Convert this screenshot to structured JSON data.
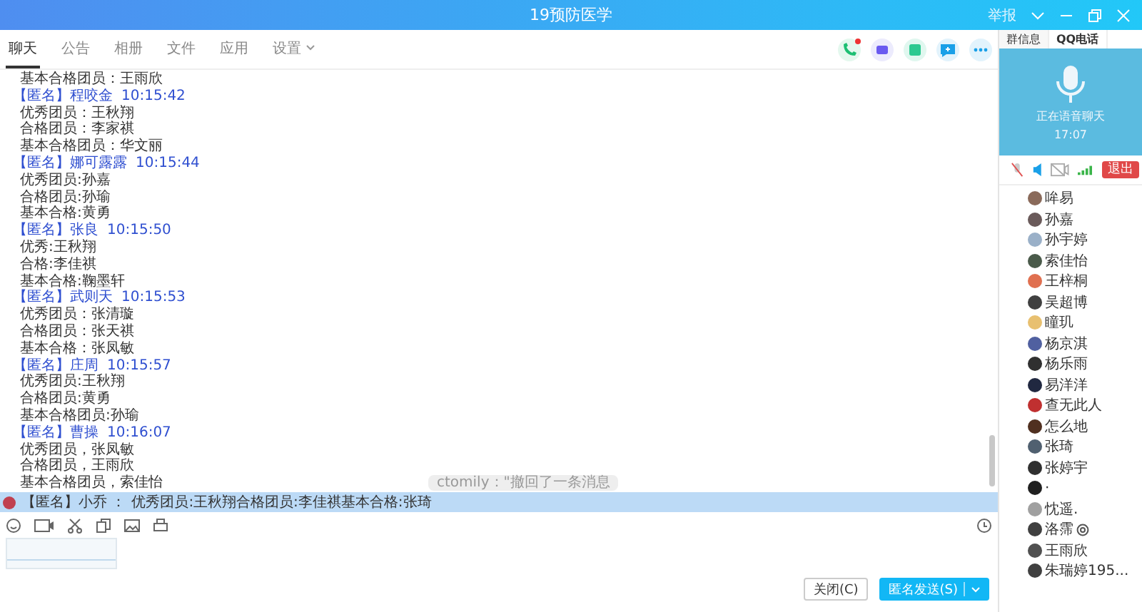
{
  "window": {
    "title": "19预防医学",
    "report": "举报"
  },
  "tabs": [
    {
      "label": "聊天",
      "selected": true
    },
    {
      "label": "公告",
      "selected": false
    },
    {
      "label": "相册",
      "selected": false
    },
    {
      "label": "文件",
      "selected": false
    },
    {
      "label": "应用",
      "selected": false
    },
    {
      "label": "设置",
      "selected": false,
      "dropdown": true
    }
  ],
  "messages": [
    {
      "lines": [
        "基本合格团员：王雨欣"
      ]
    },
    {
      "sender": "【匿名】程咬金",
      "time": "10:15:42",
      "lines": [
        "优秀团员：王秋翔",
        "合格团员：李家祺",
        "基本合格团员：华文丽"
      ]
    },
    {
      "sender": "【匿名】娜可露露",
      "time": "10:15:44",
      "lines": [
        "优秀团员:孙嘉",
        "合格团员:孙瑜",
        "基本合格:黄勇"
      ]
    },
    {
      "sender": "【匿名】张良",
      "time": "10:15:50",
      "lines": [
        "优秀:王秋翔",
        "合格:李佳祺",
        "基本合格:鞠墨轩"
      ]
    },
    {
      "sender": "【匿名】武则天",
      "time": "10:15:53",
      "lines": [
        "优秀团员：张清璇",
        "合格团员：张天祺",
        "基本合格：张凤敏"
      ]
    },
    {
      "sender": "【匿名】庄周",
      "time": "10:15:57",
      "lines": [
        "优秀团员:王秋翔",
        "合格团员:黄勇",
        "基本合格团员:孙瑜"
      ]
    },
    {
      "sender": "【匿名】曹操",
      "time": "10:16:07",
      "lines": [
        "优秀团员，张凤敏",
        "合格团员，王雨欣",
        "基本合格团员，索佳怡"
      ]
    }
  ],
  "recall_tip": "ctomily：\"撤回了一条消息",
  "notice": {
    "sender": "【匿名】小乔 ：",
    "text": "优秀团员:王秋翔合格团员:李佳祺基本合格:张琦"
  },
  "buttons": {
    "close": "关闭(C)",
    "send": "匿名发送(S)"
  },
  "side_tabs": [
    {
      "label": "群信息",
      "selected": false
    },
    {
      "label": "QQ电话",
      "selected": true
    }
  ],
  "call": {
    "status": "正在语音聊天",
    "duration": "17:07",
    "mic_muted": true,
    "exit": "退出"
  },
  "members": [
    {
      "name": "哞易",
      "color": "#8a6a5a"
    },
    {
      "name": "孙嘉",
      "color": "#6a5a5a"
    },
    {
      "name": "孙宇婷",
      "color": "#9ab0c8"
    },
    {
      "name": "索佳怡",
      "color": "#4a5a4a"
    },
    {
      "name": "王梓桐",
      "color": "#e07050"
    },
    {
      "name": "吴超博",
      "color": "#404040"
    },
    {
      "name": "瞳玑",
      "color": "#e8c070"
    },
    {
      "name": "杨京淇",
      "color": "#5060a0"
    },
    {
      "name": "杨乐雨",
      "color": "#303030"
    },
    {
      "name": "易洋洋",
      "color": "#202840"
    },
    {
      "name": "查无此人",
      "color": "#c03030"
    },
    {
      "name": "怎么地",
      "color": "#503020"
    },
    {
      "name": "张琦",
      "color": "#506070"
    },
    {
      "name": "张婷宇",
      "color": "#303030"
    },
    {
      "name": "·",
      "color": "#202020"
    },
    {
      "name": "忱遥.",
      "color": "#a0a0a0"
    },
    {
      "name": "洛霈",
      "color": "#404040",
      "badge": true
    },
    {
      "name": "王雨欣",
      "color": "#505050"
    },
    {
      "name": "朱瑞婷195...",
      "color": "#404040"
    }
  ]
}
